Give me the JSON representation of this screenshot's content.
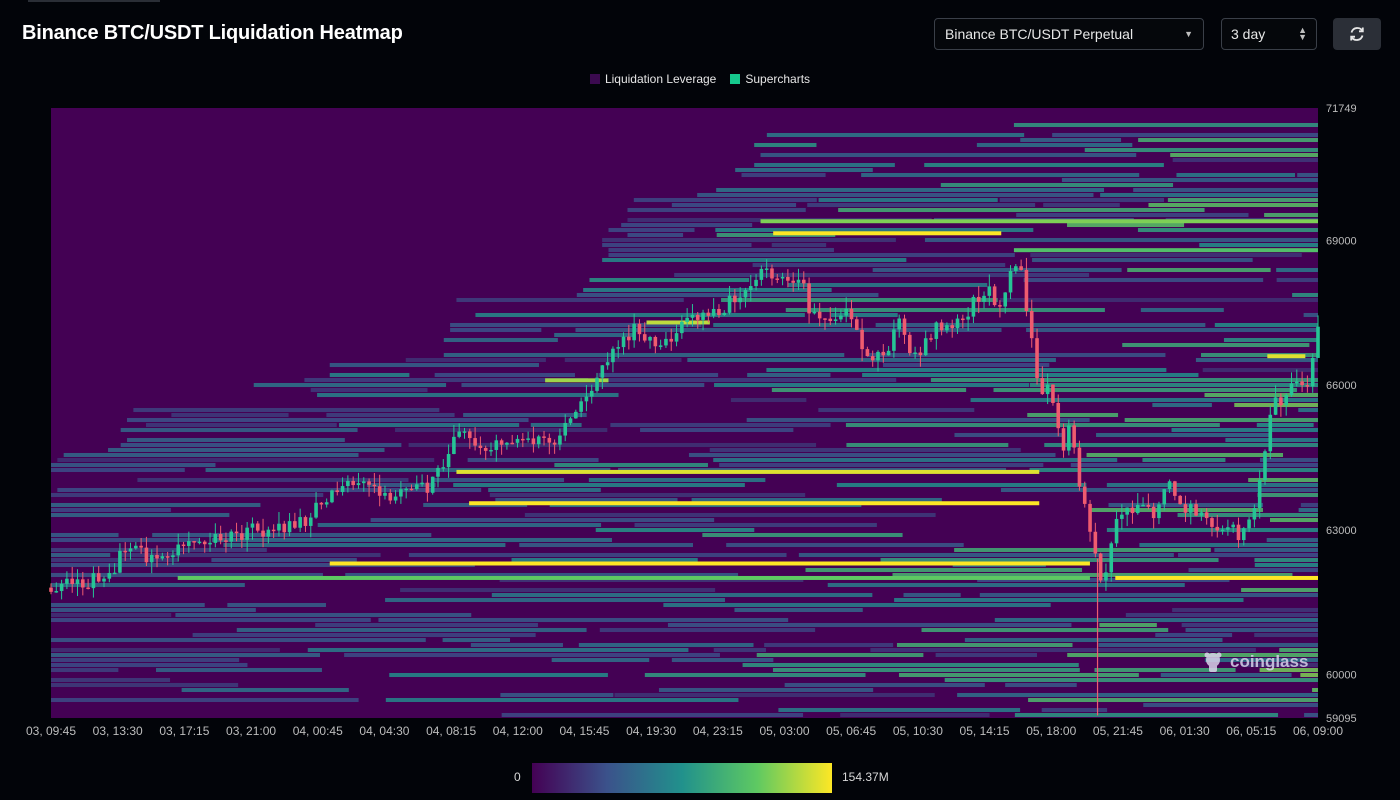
{
  "header": {
    "title": "Binance BTC/USDT Liquidation Heatmap",
    "pair_select": "Binance BTC/USDT Perpetual",
    "interval_select": "3 day",
    "refresh_icon": "refresh-icon"
  },
  "colors": {
    "background": "#020409",
    "heat_low": "#440154",
    "heat_mid": "#21918c",
    "heat_high_green": "#5ec962",
    "heat_max": "#fde725",
    "candle_up": "#26c495",
    "candle_down": "#ef5b6f"
  },
  "legend": {
    "items": [
      {
        "label": "Liquidation Leverage",
        "color": "#3b0a4f"
      },
      {
        "label": "Supercharts",
        "color": "#16c98d"
      }
    ]
  },
  "colorbar": {
    "min_label": "0",
    "max_label": "154.37M"
  },
  "watermark": {
    "text": "coinglass",
    "icon": "coinglass-logo-icon"
  },
  "chart_data": {
    "type": "heatmap",
    "title": "Binance BTC/USDT Liquidation Heatmap",
    "ylim": [
      59095,
      71749
    ],
    "y_ticks": [
      {
        "value": 71749,
        "label": "71749"
      },
      {
        "value": 69000,
        "label": "69000"
      },
      {
        "value": 66000,
        "label": "66000"
      },
      {
        "value": 63000,
        "label": "63000"
      },
      {
        "value": 60000,
        "label": "60000"
      },
      {
        "value": 59095,
        "label": "59095"
      }
    ],
    "x_ticks": [
      "03, 09:45",
      "03, 13:30",
      "03, 17:15",
      "03, 21:00",
      "04, 00:45",
      "04, 04:30",
      "04, 08:15",
      "04, 12:00",
      "04, 15:45",
      "04, 19:30",
      "04, 23:15",
      "05, 03:00",
      "05, 06:45",
      "05, 10:30",
      "05, 14:15",
      "05, 18:00",
      "05, 21:45",
      "06, 01:30",
      "06, 05:15",
      "06, 09:00"
    ],
    "color_scale": {
      "min": 0,
      "max": 154370000,
      "min_label": "0",
      "max_label": "154.37M"
    },
    "price_path": [
      [
        0,
        61800
      ],
      [
        3,
        61900
      ],
      [
        5,
        62200
      ],
      [
        6,
        62700
      ],
      [
        8,
        62400
      ],
      [
        10,
        62600
      ],
      [
        11,
        62800
      ],
      [
        12,
        62700
      ],
      [
        15,
        62900
      ],
      [
        16,
        63200
      ],
      [
        17,
        62900
      ],
      [
        18,
        63000
      ],
      [
        20,
        63200
      ],
      [
        22,
        63700
      ],
      [
        24,
        64100
      ],
      [
        25,
        63900
      ],
      [
        27,
        63700
      ],
      [
        30,
        63900
      ],
      [
        32,
        65000
      ],
      [
        34,
        64700
      ],
      [
        37,
        64800
      ],
      [
        40,
        64900
      ],
      [
        41,
        65200
      ],
      [
        42,
        65700
      ],
      [
        44,
        66500
      ],
      [
        46,
        67200
      ],
      [
        48,
        66800
      ],
      [
        50,
        67300
      ],
      [
        53,
        67600
      ],
      [
        55,
        68000
      ],
      [
        56,
        68400
      ],
      [
        58,
        68200
      ],
      [
        59,
        68300
      ],
      [
        60,
        67500
      ],
      [
        62,
        67300
      ],
      [
        63,
        67600
      ],
      [
        64,
        66700
      ],
      [
        65,
        66600
      ],
      [
        66,
        66800
      ],
      [
        67,
        67300
      ],
      [
        68,
        66500
      ],
      [
        70,
        67200
      ],
      [
        72,
        67300
      ],
      [
        73,
        67800
      ],
      [
        74,
        68000
      ],
      [
        75,
        67600
      ],
      [
        76,
        68600
      ],
      [
        76.5,
        68500
      ],
      [
        77,
        67600
      ],
      [
        78,
        66000
      ],
      [
        79,
        65800
      ],
      [
        80,
        64500
      ],
      [
        80.5,
        65500
      ],
      [
        81,
        64000
      ],
      [
        82,
        63000
      ],
      [
        82.5,
        62400
      ],
      [
        83,
        61600
      ],
      [
        83.5,
        62500
      ],
      [
        84,
        63200
      ],
      [
        85,
        63500
      ],
      [
        86,
        63400
      ],
      [
        87,
        63300
      ],
      [
        88,
        64000
      ],
      [
        89,
        63600
      ],
      [
        90,
        63400
      ],
      [
        91,
        63200
      ],
      [
        92,
        62900
      ],
      [
        93,
        63100
      ],
      [
        94,
        62800
      ],
      [
        95,
        63600
      ],
      [
        96,
        64800
      ],
      [
        96.5,
        66100
      ],
      [
        97,
        65400
      ],
      [
        98,
        66200
      ],
      [
        99,
        65900
      ],
      [
        100,
        67100
      ]
    ],
    "liquidation_levels": [
      {
        "price": 62300,
        "x_start": 22,
        "x_end": 82,
        "intensity": 1.0
      },
      {
        "price": 62000,
        "x_start": 10,
        "x_end": 82,
        "intensity": 0.75
      },
      {
        "price": 63550,
        "x_start": 33,
        "x_end": 78,
        "intensity": 1.0
      },
      {
        "price": 64200,
        "x_start": 32,
        "x_end": 78,
        "intensity": 0.95
      },
      {
        "price": 69150,
        "x_start": 57,
        "x_end": 75,
        "intensity": 1.0
      },
      {
        "price": 69400,
        "x_start": 56,
        "x_end": 100,
        "intensity": 0.8
      },
      {
        "price": 62000,
        "x_start": 84,
        "x_end": 100,
        "intensity": 1.0
      },
      {
        "price": 68800,
        "x_start": 76,
        "x_end": 100,
        "intensity": 0.7
      },
      {
        "price": 67300,
        "x_start": 47,
        "x_end": 52,
        "intensity": 0.9
      },
      {
        "price": 66100,
        "x_start": 39,
        "x_end": 44,
        "intensity": 0.85
      },
      {
        "price": 66600,
        "x_start": 96,
        "x_end": 99,
        "intensity": 0.95
      }
    ]
  }
}
